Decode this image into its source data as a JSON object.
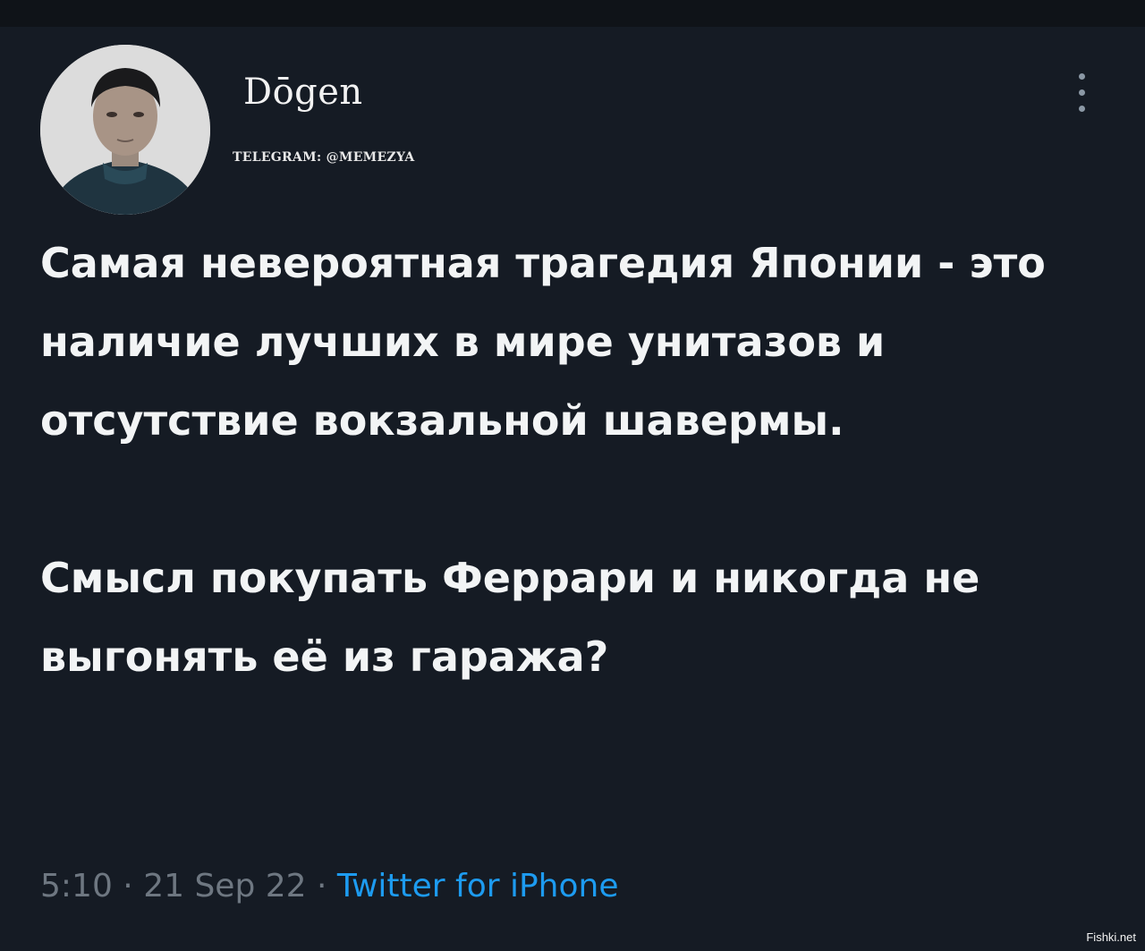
{
  "author": {
    "display_name": "Dōgen",
    "subtitle": "TELEGRAM: @MEMEZYA"
  },
  "tweet": {
    "paragraphs": [
      "Самая невероятная трагедия Японии - это наличие лучших в мире унитазов и отсутствие вокзальной шавермы.",
      "Смысл покупать Феррари и никогда не выгонять её из гаража?"
    ],
    "time": "5:10",
    "date": "21 Sep 22",
    "separator": "·",
    "source": "Twitter for iPhone"
  },
  "icons": {
    "more": "more-vertical-icon"
  },
  "watermark": "Fishki.net",
  "colors": {
    "background": "#151b24",
    "text": "#f2f4f5",
    "meta": "#6e7781",
    "link": "#1d9bf0"
  }
}
